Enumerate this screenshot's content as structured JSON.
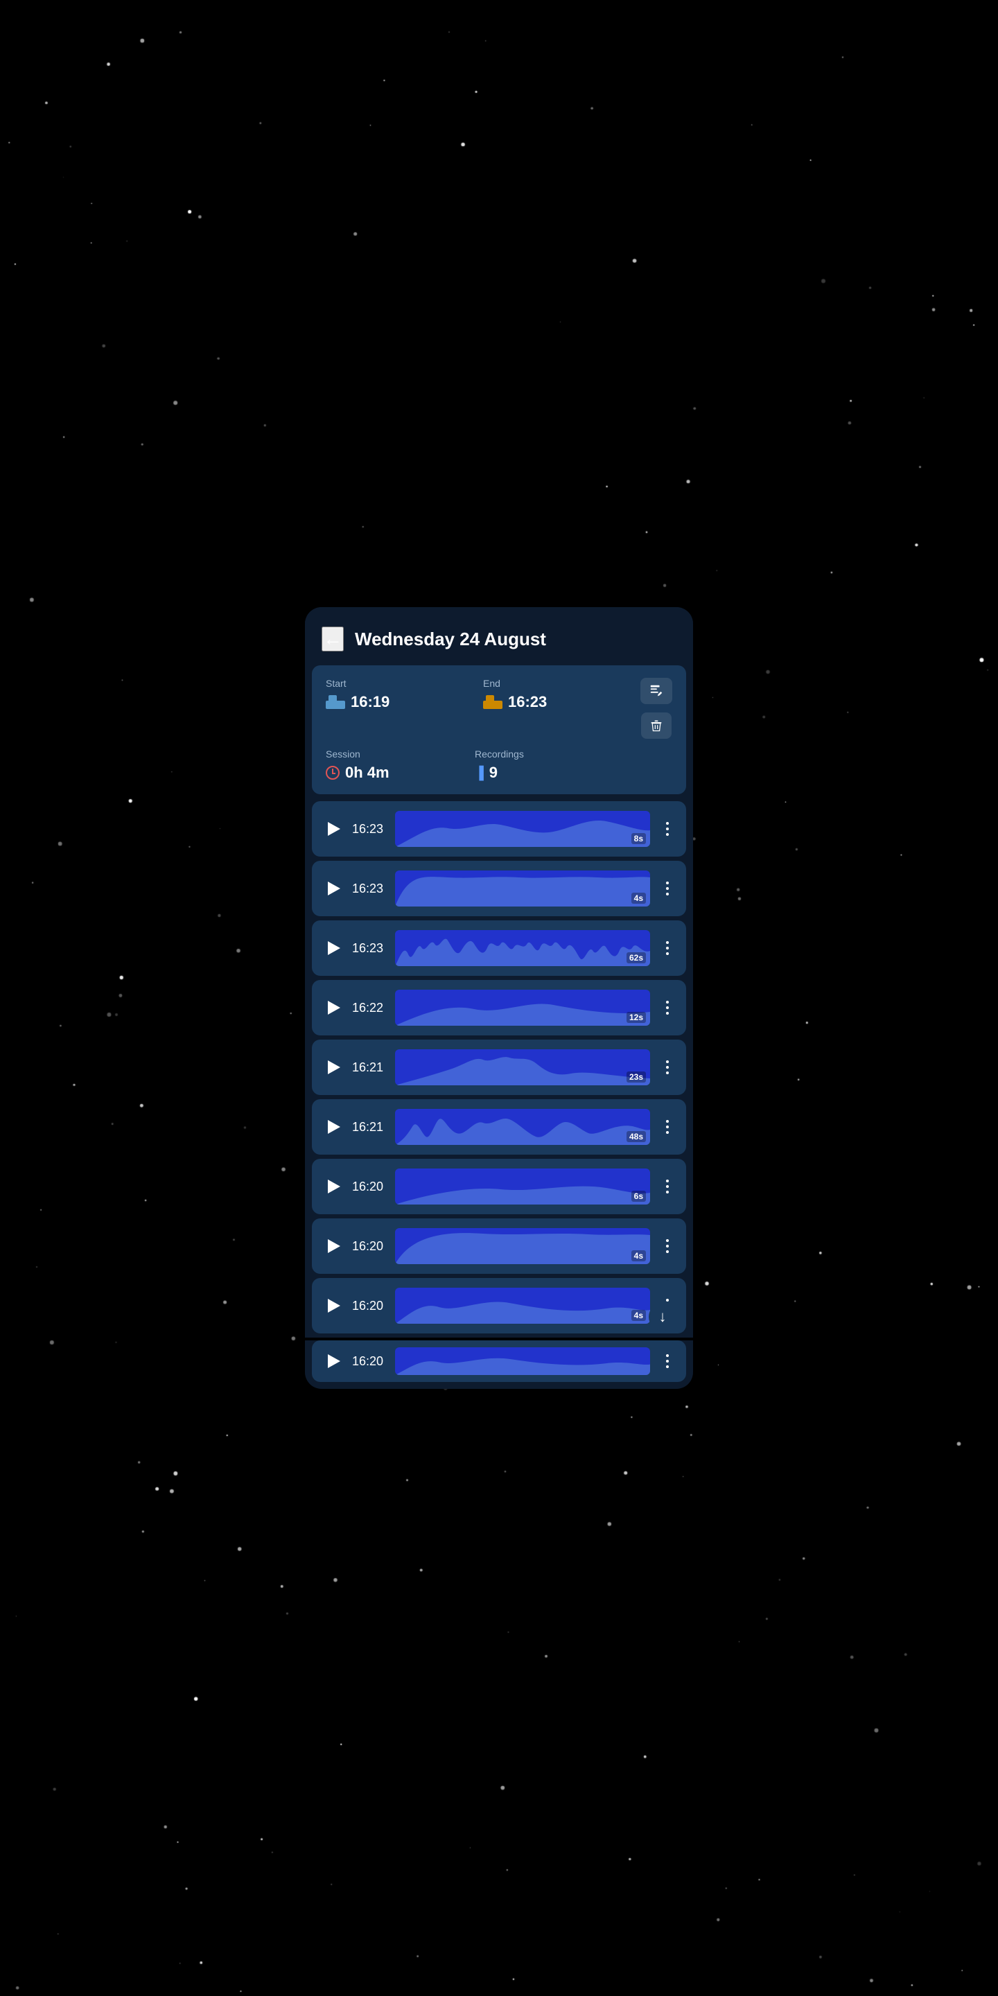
{
  "background": {
    "color": "#000014"
  },
  "header": {
    "back_label": "←",
    "title": "Wednesday 24 August"
  },
  "session": {
    "start_label": "Start",
    "start_time": "16:19",
    "end_label": "End",
    "end_time": "16:23",
    "session_label": "Session",
    "session_duration": "0h 4m",
    "recordings_label": "Recordings",
    "recordings_count": "9",
    "edit_icon": "✏",
    "delete_icon": "🗑"
  },
  "recordings": [
    {
      "time": "16:23",
      "duration": "8s",
      "fill_pct": 100
    },
    {
      "time": "16:23",
      "duration": "4s",
      "fill_pct": 100
    },
    {
      "time": "16:23",
      "duration": "62s",
      "fill_pct": 100
    },
    {
      "time": "16:22",
      "duration": "12s",
      "fill_pct": 100
    },
    {
      "time": "16:21",
      "duration": "23s",
      "fill_pct": 100
    },
    {
      "time": "16:21",
      "duration": "48s",
      "fill_pct": 100
    },
    {
      "time": "16:20",
      "duration": "6s",
      "fill_pct": 100
    },
    {
      "time": "16:20",
      "duration": "4s",
      "fill_pct": 100
    },
    {
      "time": "16:20",
      "duration": "4s",
      "fill_pct": 100
    }
  ],
  "scroll_arrow": "↓"
}
